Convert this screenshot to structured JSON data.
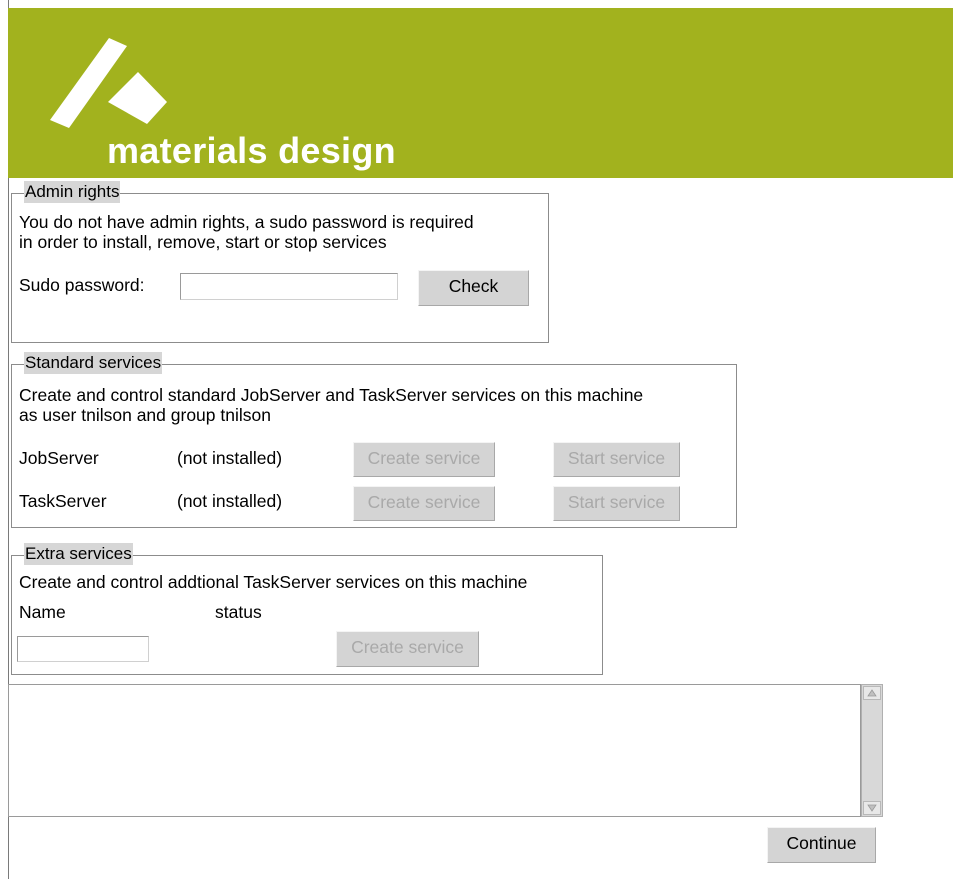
{
  "brand": {
    "name": "materials design",
    "color": "#a2b21e"
  },
  "admin": {
    "title": "Admin rights",
    "message_line1": "You do not have admin rights, a sudo password is required",
    "message_line2": "in order to install, remove, start or stop services",
    "password_label": "Sudo password:",
    "password_value": "",
    "check_label": "Check"
  },
  "standard": {
    "title": "Standard services",
    "desc_line1": "Create and control standard JobServer and TaskServer services on this machine",
    "desc_line2": "as user tnilson and group tnilson",
    "services": [
      {
        "name": "JobServer",
        "status": "(not installed)",
        "create_label": "Create service",
        "start_label": "Start service"
      },
      {
        "name": "TaskServer",
        "status": "(not installed)",
        "create_label": "Create service",
        "start_label": "Start service"
      }
    ]
  },
  "extra": {
    "title": "Extra services",
    "desc": "Create and control addtional TaskServer services on this machine",
    "col_name": "Name",
    "col_status": "status",
    "name_value": "",
    "create_label": "Create service"
  },
  "log": {
    "text": ""
  },
  "footer": {
    "continue_label": "Continue"
  }
}
